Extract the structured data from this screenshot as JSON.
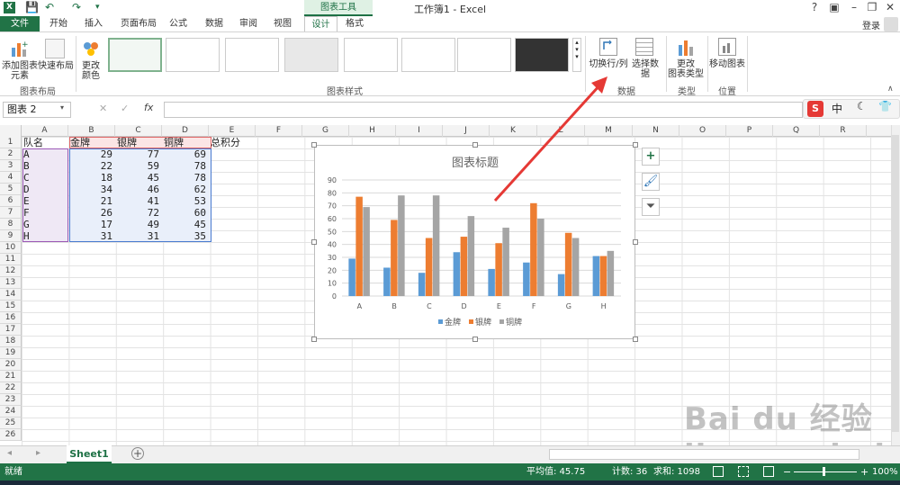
{
  "window": {
    "title": "工作簿1 - Excel",
    "context_tab_label": "图表工具",
    "help": "?",
    "login": "登录"
  },
  "tabs": [
    "文件",
    "开始",
    "插入",
    "页面布局",
    "公式",
    "数据",
    "审阅",
    "视图",
    "设计",
    "格式"
  ],
  "active_tab": "设计",
  "ribbon": {
    "add_element": "添加图表\n元素",
    "quick_layout": "快速布局",
    "change_color": "更改\n颜色",
    "switch_row_col": "切换行/列",
    "select_data": "选择数据",
    "change_type": "更改\n图表类型",
    "move_chart": "移动图表",
    "groups": {
      "layout": "图表布局",
      "styles": "图表样式",
      "data": "数据",
      "type": "类型",
      "location": "位置"
    }
  },
  "formula_bar": {
    "name_box": "图表 2",
    "fx": "fx",
    "value": ""
  },
  "ime": {
    "lang": "中"
  },
  "columns": [
    "A",
    "B",
    "C",
    "D",
    "E",
    "F",
    "G",
    "H",
    "I",
    "J",
    "K",
    "L",
    "M",
    "N",
    "O",
    "P",
    "Q",
    "R"
  ],
  "rows": [
    "1",
    "2",
    "3",
    "4",
    "5",
    "6",
    "7",
    "8",
    "9",
    "10",
    "11",
    "12",
    "13",
    "14",
    "15",
    "16",
    "17",
    "18",
    "19",
    "20",
    "21",
    "22",
    "23",
    "24",
    "25",
    "26"
  ],
  "table": {
    "headers": [
      "队名",
      "金牌",
      "银牌",
      "铜牌",
      "总积分"
    ],
    "rows": [
      [
        "A",
        "29",
        "77",
        "69"
      ],
      [
        "B",
        "22",
        "59",
        "78"
      ],
      [
        "C",
        "18",
        "45",
        "78"
      ],
      [
        "D",
        "34",
        "46",
        "62"
      ],
      [
        "E",
        "21",
        "41",
        "53"
      ],
      [
        "F",
        "26",
        "72",
        "60"
      ],
      [
        "G",
        "17",
        "49",
        "45"
      ],
      [
        "H",
        "31",
        "31",
        "35"
      ]
    ]
  },
  "chart_data": {
    "type": "bar",
    "title": "图表标题",
    "categories": [
      "A",
      "B",
      "C",
      "D",
      "E",
      "F",
      "G",
      "H"
    ],
    "series": [
      {
        "name": "金牌",
        "color": "#5b9bd5",
        "values": [
          29,
          22,
          18,
          34,
          21,
          26,
          17,
          31
        ]
      },
      {
        "name": "银牌",
        "color": "#ed7d31",
        "values": [
          77,
          59,
          45,
          46,
          41,
          72,
          49,
          31
        ]
      },
      {
        "name": "铜牌",
        "color": "#a5a5a5",
        "values": [
          69,
          78,
          78,
          62,
          53,
          60,
          45,
          35
        ]
      }
    ],
    "yticks": [
      "0",
      "10",
      "20",
      "30",
      "40",
      "50",
      "60",
      "70",
      "80",
      "90"
    ],
    "ylim": [
      0,
      90
    ],
    "legend": "bottom",
    "grid": true
  },
  "sheets": [
    "Sheet1"
  ],
  "status": {
    "ready": "就绪",
    "average": "平均值: 45.75",
    "count": "计数: 36",
    "sum": "求和: 1098",
    "zoom": "100%"
  },
  "watermark": "Bai du 经验 jingyan.baidu.com",
  "colors": {
    "excel_green": "#217346",
    "arrow_red": "#e53935"
  }
}
